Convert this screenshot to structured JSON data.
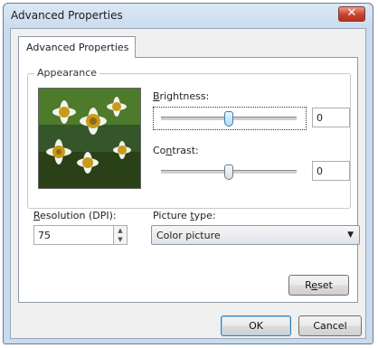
{
  "window": {
    "title": "Advanced Properties",
    "close_symbol": "✕"
  },
  "tab": {
    "label": "Advanced Properties"
  },
  "appearance": {
    "group_title": "Appearance",
    "brightness": {
      "label_prefix": "",
      "label_underline": "B",
      "label_rest": "rightness:",
      "value": "0",
      "slider_level": 0.5
    },
    "contrast": {
      "label_prefix": "Co",
      "label_underline": "n",
      "label_rest": "trast:",
      "value": "0",
      "slider_level": 0.5
    }
  },
  "resolution": {
    "label_prefix": "",
    "label_underline": "R",
    "label_rest": "esolution (DPI):",
    "value": "75"
  },
  "picture_type": {
    "label_prefix": "Picture ",
    "label_underline": "t",
    "label_rest": "ype:",
    "value": "Color picture"
  },
  "buttons": {
    "reset_prefix": "R",
    "reset_underline": "e",
    "reset_rest": "set",
    "ok": "OK",
    "cancel": "Cancel"
  },
  "icons": {
    "close": "close-icon",
    "dropdown": "chevron-down-icon"
  }
}
